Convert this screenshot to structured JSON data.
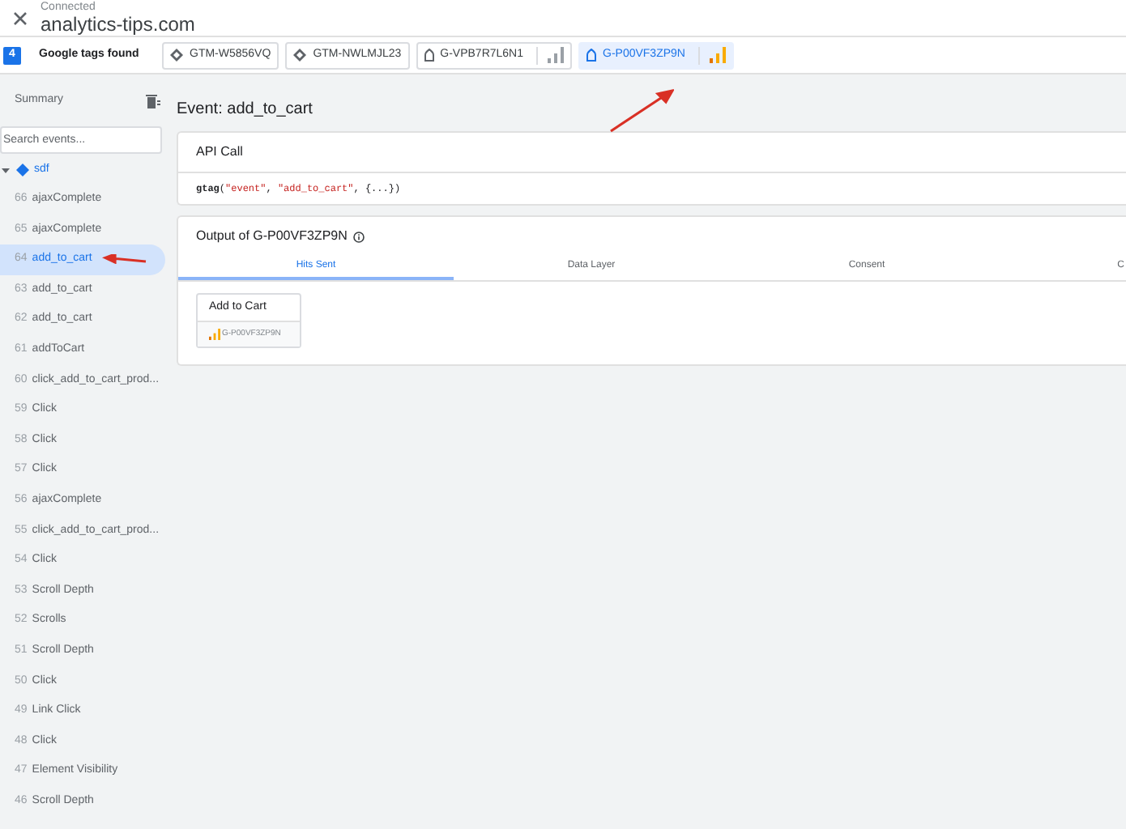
{
  "header": {
    "status": "Connected",
    "site": "analytics-tips.com"
  },
  "tags_bar": {
    "count": "4",
    "label": "Google tags found",
    "tags": [
      {
        "kind": "container",
        "label": "GTM-W5856VQ",
        "selected": false,
        "bars": false
      },
      {
        "kind": "container",
        "label": "GTM-NWLMJL23",
        "selected": false,
        "bars": false
      },
      {
        "kind": "ga",
        "label": "G-VPB7R7L6N1",
        "selected": false,
        "bars": true
      },
      {
        "kind": "ga",
        "label": "G-P00VF3ZP9N",
        "selected": true,
        "bars": true
      }
    ]
  },
  "sidebar": {
    "summary": "Summary",
    "search": {
      "placeholder": "Search events..."
    },
    "group": {
      "label": "sdf",
      "expanded": true
    },
    "events": [
      {
        "number": "66",
        "label": "ajaxComplete",
        "selected": false
      },
      {
        "number": "65",
        "label": "ajaxComplete",
        "selected": false
      },
      {
        "number": "64",
        "label": "add_to_cart",
        "selected": true
      },
      {
        "number": "63",
        "label": "add_to_cart",
        "selected": false
      },
      {
        "number": "62",
        "label": "add_to_cart",
        "selected": false
      },
      {
        "number": "61",
        "label": "addToCart",
        "selected": false
      },
      {
        "number": "60",
        "label": "click_add_to_cart_prod...",
        "selected": false
      },
      {
        "number": "59",
        "label": "Click",
        "selected": false
      },
      {
        "number": "58",
        "label": "Click",
        "selected": false
      },
      {
        "number": "57",
        "label": "Click",
        "selected": false
      },
      {
        "number": "56",
        "label": "ajaxComplete",
        "selected": false
      },
      {
        "number": "55",
        "label": "click_add_to_cart_prod...",
        "selected": false
      },
      {
        "number": "54",
        "label": "Click",
        "selected": false
      },
      {
        "number": "53",
        "label": "Scroll Depth",
        "selected": false
      },
      {
        "number": "52",
        "label": "Scrolls",
        "selected": false
      },
      {
        "number": "51",
        "label": "Scroll Depth",
        "selected": false
      },
      {
        "number": "50",
        "label": "Click",
        "selected": false
      },
      {
        "number": "49",
        "label": "Link Click",
        "selected": false
      },
      {
        "number": "48",
        "label": "Click",
        "selected": false
      },
      {
        "number": "47",
        "label": "Element Visibility",
        "selected": false
      },
      {
        "number": "46",
        "label": "Scroll Depth",
        "selected": false
      }
    ]
  },
  "main": {
    "title": "Event: add_to_cart",
    "api_call": {
      "title": "API Call",
      "code": [
        {
          "kind": "fn",
          "text": "gtag"
        },
        {
          "kind": "punct",
          "text": "("
        },
        {
          "kind": "string",
          "text": "\"event\""
        },
        {
          "kind": "punct",
          "text": ", "
        },
        {
          "kind": "string",
          "text": "\"add_to_cart\""
        },
        {
          "kind": "punct",
          "text": ", {...})"
        }
      ]
    },
    "output": {
      "title": "Output of G-P00VF3ZP9N",
      "tabs": [
        {
          "label": "Hits Sent",
          "selected": true
        },
        {
          "label": "Data Layer",
          "selected": false
        },
        {
          "label": "Consent",
          "selected": false
        },
        {
          "label": "C",
          "selected": false
        }
      ],
      "hits": [
        {
          "title": "Add to Cart",
          "tag": "G-P00VF3ZP9N"
        }
      ]
    }
  }
}
